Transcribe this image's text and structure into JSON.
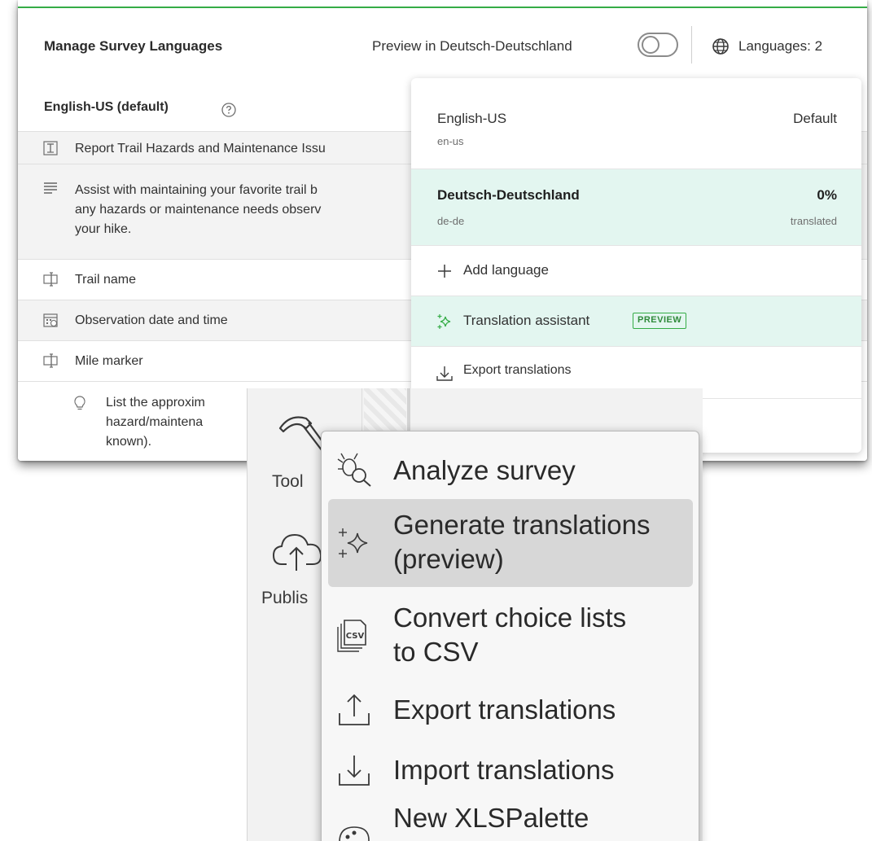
{
  "header": {
    "title": "Manage Survey Languages",
    "preview_label": "Preview in Deutsch-Deutschland",
    "languages_label": "Languages: 2"
  },
  "survey": {
    "default_language": "English-US (default)",
    "items": [
      {
        "icon": "form-title-icon",
        "text": "Report Trail Hazards and Maintenance Issu"
      },
      {
        "icon": "description-icon",
        "text": "Assist with maintaining your favorite trail b",
        "text2": "any hazards or maintenance needs observ",
        "text3": "your hike."
      },
      {
        "icon": "text-field-icon",
        "text": "Trail name"
      },
      {
        "icon": "date-time-icon",
        "text": "Observation date and time"
      },
      {
        "icon": "text-field-icon",
        "text": "Mile marker"
      },
      {
        "icon": "hint-bulb-icon",
        "text": "List the approxim",
        "text2": "hazard/maintena",
        "text3": "known)."
      }
    ]
  },
  "language_menu": {
    "languages": [
      {
        "name": "English-US",
        "code": "en-us",
        "status": "Default"
      },
      {
        "name": "Deutsch-Deutschland",
        "code": "de-de",
        "percent": "0%",
        "status": "translated"
      }
    ],
    "actions": [
      {
        "icon": "plus-icon",
        "label": "Add language"
      },
      {
        "icon": "sparkle-icon",
        "label": "Translation assistant",
        "badge": "PREVIEW"
      },
      {
        "icon": "download-icon",
        "label": "Export translations"
      }
    ]
  },
  "ribbon": {
    "tools_label": "Tool",
    "publish_label": "Publis"
  },
  "tools_menu": {
    "items": [
      {
        "icon": "analyze-bug-icon",
        "label": "Analyze survey"
      },
      {
        "icon": "sparkle-icon",
        "label": "Generate translations",
        "label2": "(preview)",
        "selected": true
      },
      {
        "icon": "csv-file-icon",
        "label": "Convert choice lists",
        "label2": "to CSV"
      },
      {
        "icon": "export-icon",
        "label": "Export translations"
      },
      {
        "icon": "import-icon",
        "label": "Import translations"
      },
      {
        "icon": "palette-icon",
        "label": "New XLSPalette"
      }
    ]
  },
  "colors": {
    "accent_green": "#35ac46",
    "selected_row_teal": "#e3f6f0",
    "menu_selected": "#d7d7d7"
  }
}
